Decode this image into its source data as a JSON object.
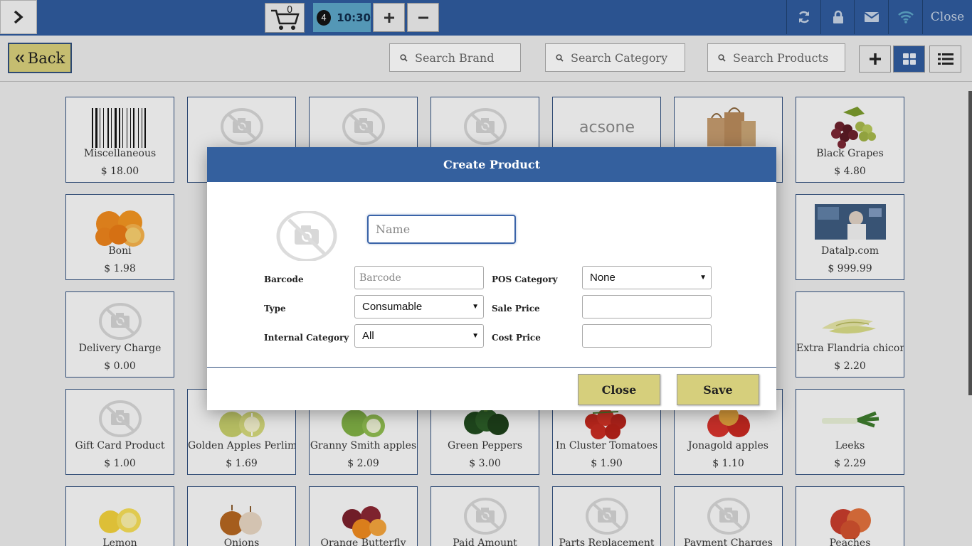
{
  "topbar": {
    "cart_count": "0",
    "order_number": "4",
    "order_time": "10:30",
    "close_label": "Close",
    "icons": [
      "chevron-right-icon",
      "cart-icon",
      "plus-icon",
      "minus-icon",
      "refresh-icon",
      "lock-icon",
      "mail-icon",
      "wifi-icon"
    ]
  },
  "subbar": {
    "back_label": "Back",
    "search_brand_placeholder": "Search Brand",
    "search_category_placeholder": "Search Category",
    "search_products_placeholder": "Search Products"
  },
  "products": [
    {
      "name": "Miscellaneous",
      "price": "$ 18.00",
      "image": "barcode"
    },
    {
      "name": "",
      "price": "",
      "image": "placeholder"
    },
    {
      "name": "",
      "price": "",
      "image": "placeholder"
    },
    {
      "name": "",
      "price": "",
      "image": "placeholder"
    },
    {
      "name": "",
      "price": "",
      "image": "acsone-logo",
      "logo_text": "acsone"
    },
    {
      "name": "",
      "price": "",
      "image": "paper-bags"
    },
    {
      "name": "Black Grapes",
      "price": "$ 4.80",
      "image": "grapes"
    },
    {
      "name": "Boni",
      "price": "$ 1.98",
      "image": "oranges"
    },
    {
      "name": "Datalp.com",
      "price": "$ 999.99",
      "image": "datalp"
    },
    {
      "name": "Delivery Charge",
      "price": "$ 0.00",
      "image": "placeholder"
    },
    {
      "name": "Extra Flandria chicory",
      "price": "$ 2.20",
      "image": "chicory"
    },
    {
      "name": "Gift Card Product",
      "price": "$ 1.00",
      "image": "placeholder"
    },
    {
      "name": "Golden Apples Perlim",
      "price": "$ 1.69",
      "image": "golden-apples"
    },
    {
      "name": "Granny Smith apples",
      "price": "$ 2.09",
      "image": "granny-apples"
    },
    {
      "name": "Green Peppers",
      "price": "$ 3.00",
      "image": "peppers"
    },
    {
      "name": "In Cluster Tomatoes",
      "price": "$ 1.90",
      "image": "tomatoes"
    },
    {
      "name": "Jonagold apples",
      "price": "$ 1.10",
      "image": "jonagold"
    },
    {
      "name": "Leeks",
      "price": "$ 2.29",
      "image": "leeks"
    },
    {
      "name": "Lemon",
      "price": "",
      "image": "lemon"
    },
    {
      "name": "Onions",
      "price": "",
      "image": "onions"
    },
    {
      "name": "Orange Butterfly",
      "price": "",
      "image": "orange-butterfly"
    },
    {
      "name": "Paid Amount",
      "price": "",
      "image": "placeholder"
    },
    {
      "name": "Parts Replacement",
      "price": "",
      "image": "placeholder"
    },
    {
      "name": "Payment Charges",
      "price": "",
      "image": "placeholder"
    },
    {
      "name": "Peaches",
      "price": "",
      "image": "peaches"
    }
  ],
  "modal": {
    "title": "Create Product",
    "name_placeholder": "Name",
    "barcode_label": "Barcode",
    "barcode_placeholder": "Barcode",
    "type_label": "Type",
    "type_value": "Consumable",
    "internal_category_label": "Internal Category",
    "internal_category_value": "All",
    "pos_category_label": "POS Category",
    "pos_category_value": "None",
    "sale_price_label": "Sale Price",
    "sale_price_value": "",
    "cost_price_label": "Cost Price",
    "cost_price_value": "",
    "close_label": "Close",
    "save_label": "Save"
  },
  "colors": {
    "topbar": "#2d5a9e",
    "modal_header": "#34609e",
    "button_yellow": "#d6cf7c",
    "order_tab": "#5ba5c8"
  }
}
